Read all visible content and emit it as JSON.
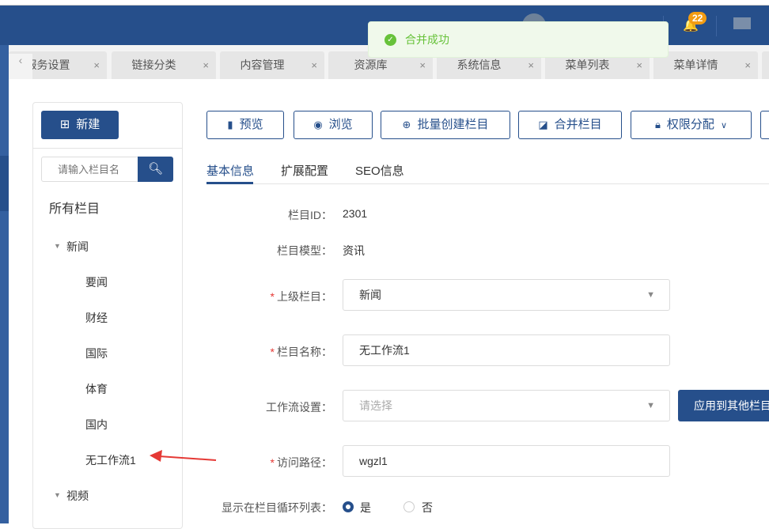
{
  "header": {
    "notification_count": "22",
    "toast": "合并成功"
  },
  "tabs": [
    {
      "label": "服务设置"
    },
    {
      "label": "链接分类"
    },
    {
      "label": "内容管理"
    },
    {
      "label": "资源库"
    },
    {
      "label": "系统信息"
    },
    {
      "label": "菜单列表"
    },
    {
      "label": "菜单详情"
    }
  ],
  "tab_close": "×",
  "tab_prev": "‹",
  "sidebar": {
    "new_label": "新建",
    "search_placeholder": "请输入栏目名",
    "all_label": "所有栏目",
    "tree": [
      {
        "label": "新闻",
        "children": [
          "要闻",
          "财经",
          "国际",
          "体育",
          "国内",
          "无工作流1"
        ]
      },
      {
        "label": "视频"
      }
    ]
  },
  "toolbar": {
    "preview": "预览",
    "browse": "浏览",
    "batch_create": "批量创建栏目",
    "merge": "合并栏目",
    "permission": "权限分配"
  },
  "form_tabs": [
    "基本信息",
    "扩展配置",
    "SEO信息"
  ],
  "form": {
    "id_label": "栏目ID：",
    "id_value": "2301",
    "model_label": "栏目模型：",
    "model_value": "资讯",
    "parent_label": "上级栏目：",
    "parent_value": "新闻",
    "name_label": "栏目名称：",
    "name_value": "无工作流1",
    "workflow_label": "工作流设置：",
    "workflow_placeholder": "请选择",
    "apply_label": "应用到其他栏目",
    "path_label": "访问路径：",
    "path_value": "wgzl1",
    "loop_label": "显示在栏目循环列表：",
    "yes": "是",
    "no": "否",
    "required_mark": "*"
  },
  "colors": {
    "primary": "#264f8b",
    "success": "#67c23a",
    "badge": "#f39c12",
    "annotation": "#e53935"
  }
}
